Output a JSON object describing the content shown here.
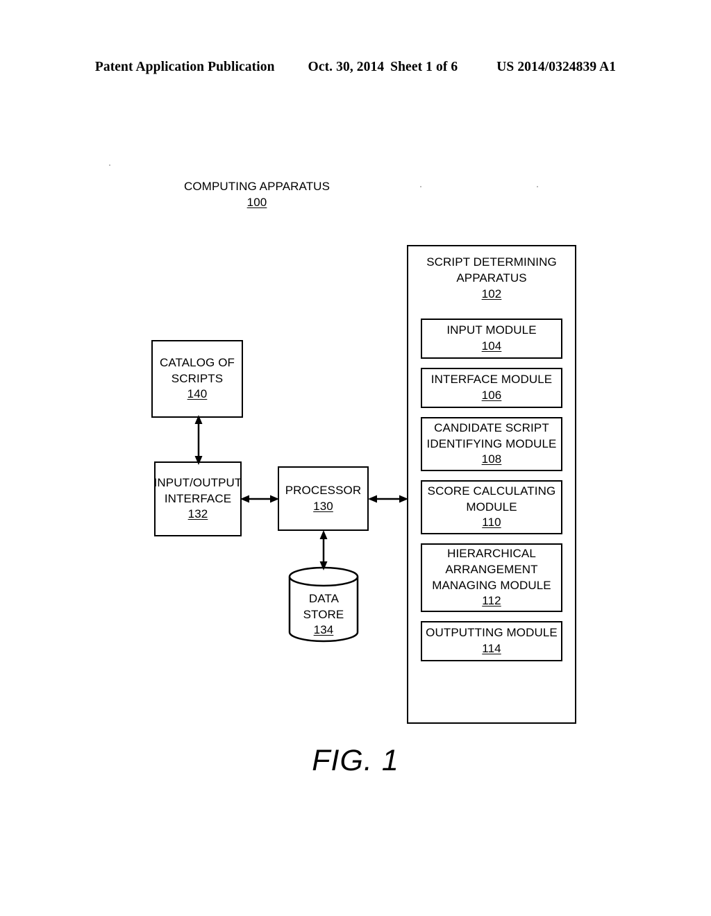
{
  "header": {
    "publication": "Patent Application Publication",
    "date": "Oct. 30, 2014",
    "sheet": "Sheet 1 of 6",
    "doc_number": "US 2014/0324839 A1"
  },
  "figure": {
    "caption": "FIG. 1",
    "outer_label": {
      "title": "COMPUTING APPARATUS",
      "ref": "100"
    },
    "apparatus": {
      "title_line1": "SCRIPT DETERMINING",
      "title_line2": "APPARATUS",
      "ref": "102",
      "modules": [
        {
          "lines": [
            "INPUT MODULE"
          ],
          "ref": "104"
        },
        {
          "lines": [
            "INTERFACE MODULE"
          ],
          "ref": "106"
        },
        {
          "lines": [
            "CANDIDATE SCRIPT",
            "IDENTIFYING MODULE"
          ],
          "ref": "108"
        },
        {
          "lines": [
            "SCORE CALCULATING",
            "MODULE"
          ],
          "ref": "110"
        },
        {
          "lines": [
            "HIERARCHICAL",
            "ARRANGEMENT",
            "MANAGING MODULE"
          ],
          "ref": "112"
        },
        {
          "lines": [
            "OUTPUTTING MODULE"
          ],
          "ref": "114"
        }
      ]
    },
    "boxes": {
      "catalog": {
        "line1": "CATALOG OF",
        "line2": "SCRIPTS",
        "ref": "140"
      },
      "io_interface": {
        "line1": "INPUT/OUTPUT",
        "line2": "INTERFACE",
        "ref": "132"
      },
      "processor": {
        "line1": "PROCESSOR",
        "ref": "130"
      },
      "data_store": {
        "line1": "DATA",
        "line2": "STORE",
        "ref": "134"
      }
    },
    "connectors": [
      {
        "name": "catalog-to-io",
        "type": "double-arrow",
        "orientation": "vertical"
      },
      {
        "name": "io-to-processor",
        "type": "double-arrow",
        "orientation": "horizontal"
      },
      {
        "name": "processor-to-apparatus",
        "type": "double-arrow",
        "orientation": "horizontal"
      },
      {
        "name": "processor-to-data-store",
        "type": "double-arrow",
        "orientation": "vertical"
      }
    ]
  },
  "colors": {
    "ink": "#000000",
    "paper": "#ffffff"
  }
}
